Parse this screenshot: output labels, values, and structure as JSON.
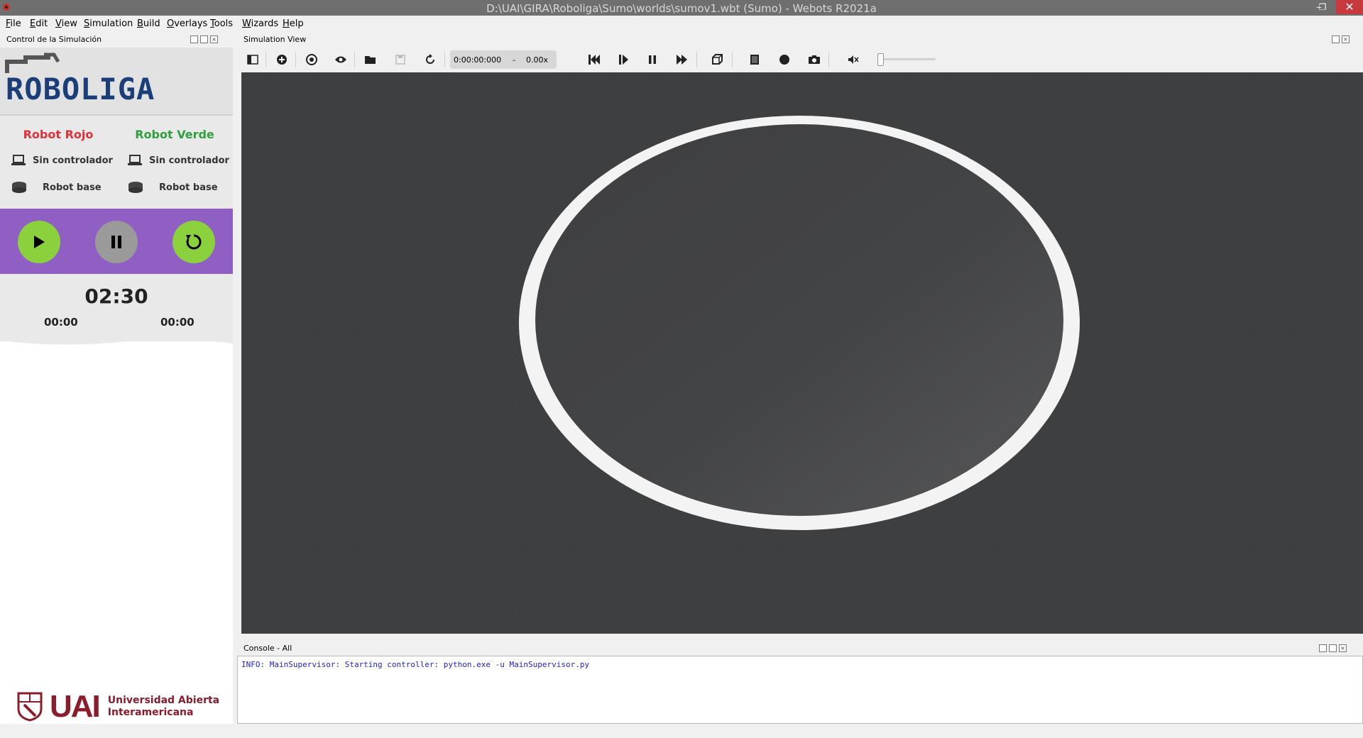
{
  "window": {
    "title": "D:\\UAI\\GIRA\\Roboliga\\Sumo\\worlds\\sumov1.wbt (Sumo) - Webots R2021a",
    "controls": {
      "minimize": "‒",
      "maximize": "❐",
      "close": "✕"
    }
  },
  "menu": [
    "File",
    "Edit",
    "View",
    "Simulation",
    "Build",
    "Overlays",
    "Tools",
    "Wizards",
    "Help"
  ],
  "left_dock": {
    "title": "Control de la Simulación",
    "logo_text": "ROBOLIGA",
    "teams": [
      {
        "name": "Robot Rojo",
        "color": "#e0303a",
        "controller": "Sin controlador",
        "robot": "Robot base"
      },
      {
        "name": "Robot Verde",
        "color": "#2e9e3e",
        "controller": "Sin controlador",
        "robot": "Robot base"
      }
    ],
    "controls": {
      "play_color": "#8bd13d",
      "pause_color": "#9a9a9a",
      "reset_color": "#8bd13d",
      "bar_color": "#8f5fc4"
    },
    "timer": {
      "main": "02:30",
      "left": "00:00",
      "right": "00:00"
    },
    "university": {
      "acronym": "UAI",
      "line1": "Universidad Abierta",
      "line2": "Interamericana",
      "color": "#8a1c2b"
    }
  },
  "sim_view": {
    "title": "Simulation View",
    "time": "0:00:00:000",
    "separator": "-",
    "speed": "0.00x",
    "icons": [
      "panel-toggle-icon",
      "add-node-icon",
      "viewpoint-icon",
      "view-icon",
      "open-world-icon",
      "save-world-icon",
      "reload-world-icon",
      "reset-simulation-icon",
      "step-icon",
      "pause-icon",
      "fast-forward-icon",
      "reset-view-icon",
      "movie-icon",
      "record-icon",
      "screenshot-icon",
      "mute-icon"
    ]
  },
  "console": {
    "title": "Console - All",
    "lines": [
      "INFO: MainSupervisor: Starting controller: python.exe -u MainSupervisor.py"
    ]
  }
}
